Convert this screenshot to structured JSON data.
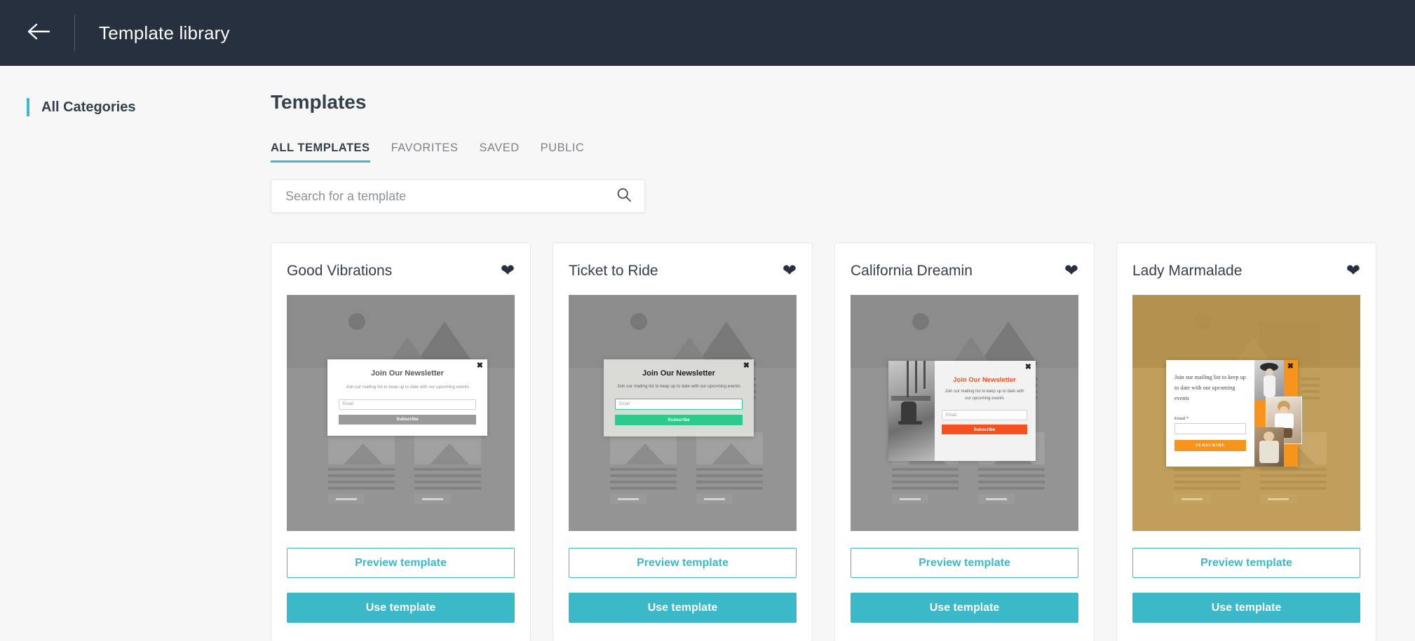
{
  "header": {
    "back_icon": "arrow-left-icon",
    "title": "Template library"
  },
  "sidebar": {
    "items": [
      {
        "label": "All Categories",
        "accent": "#3bb9c9",
        "selected": true
      }
    ]
  },
  "main": {
    "page_title": "Templates",
    "tabs": [
      {
        "label": "ALL TEMPLATES",
        "active": true
      },
      {
        "label": "FAVORITES",
        "active": false
      },
      {
        "label": "SAVED",
        "active": false
      },
      {
        "label": "PUBLIC",
        "active": false
      }
    ],
    "search": {
      "placeholder": "Search for a template",
      "value": "",
      "icon": "search-icon"
    },
    "buttons": {
      "preview_label": "Preview template",
      "use_label": "Use template"
    },
    "favorite_icon": "heart-icon",
    "close_icon": "close-icon",
    "cards": [
      {
        "title": "Good Vibrations",
        "favorited": true,
        "accent": "#9a9a9a",
        "popup": {
          "heading": "Join Our Newsletter",
          "subtext": "Join our mailing list to keep up to date with our upcoming events",
          "email_placeholder": "Email",
          "submit_label": "Subscribe"
        }
      },
      {
        "title": "Ticket to Ride",
        "favorited": true,
        "accent": "#2bcb8e",
        "popup": {
          "heading": "Join Our Newsletter",
          "subtext": "Join our mailing list to keep up to date with our upcoming events",
          "email_placeholder": "Email",
          "submit_label": "Subscribe"
        }
      },
      {
        "title": "California Dreamin",
        "favorited": true,
        "accent": "#f4511e",
        "popup": {
          "heading": "Join Our Newsletter",
          "subtext": "Join our mailing list to keep up to date with our upcoming events",
          "email_placeholder": "Email",
          "submit_label": "Subscribe"
        }
      },
      {
        "title": "Lady Marmalade",
        "favorited": true,
        "accent": "#f7941d",
        "popup": {
          "heading": "",
          "subtext": "Join our mailing list to keep up to date with our upcoming events",
          "email_label": "Email *",
          "email_placeholder": "",
          "submit_label": "SUBSCRIBE"
        }
      }
    ]
  },
  "colors": {
    "header_bg": "#26303f",
    "page_bg": "#f7f7f7",
    "accent_teal": "#3bb9c9",
    "text_dark": "#35404c"
  }
}
